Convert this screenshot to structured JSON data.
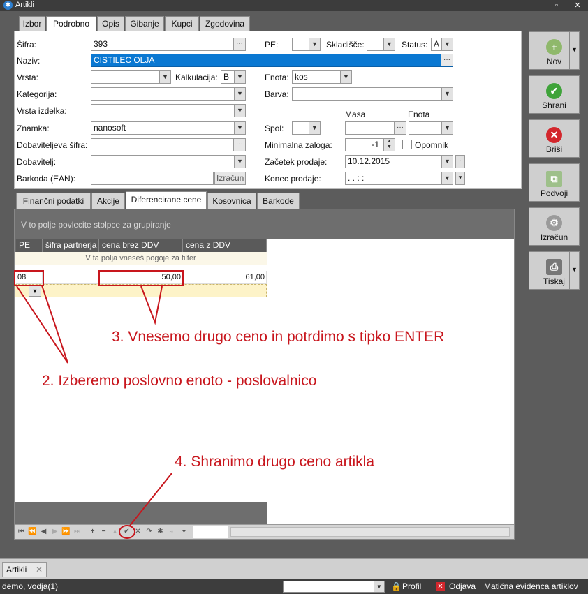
{
  "window": {
    "title": "Artikli"
  },
  "main_tabs": [
    "Izbor",
    "Podrobno",
    "Opis",
    "Gibanje",
    "Kupci",
    "Zgodovina"
  ],
  "form": {
    "sifra_label": "Šifra:",
    "sifra_value": "393",
    "naziv_label": "Naziv:",
    "naziv_value": "CISTILEC OLJA",
    "vrsta_label": "Vrsta:",
    "kalkulacija_label": "Kalkulacija:",
    "kalkulacija_value": "B",
    "kategorija_label": "Kategorija:",
    "vrsta_izdelka_label": "Vrsta izdelka:",
    "znamka_label": "Znamka:",
    "znamka_value": "nanosoft",
    "dobaviteljeva_sifra_label": "Dobaviteljeva šifra:",
    "dobavitelj_label": "Dobavitelj:",
    "barkoda_label": "Barkoda (EAN):",
    "izracun_button": "Izračun",
    "pe_label": "PE:",
    "skladisce_label": "Skladišče:",
    "status_label": "Status:",
    "status_value": "A",
    "enota_label": "Enota:",
    "enota_value": "kos",
    "barva_label": "Barva:",
    "masa_header": "Masa",
    "enota_header": "Enota",
    "spol_label": "Spol:",
    "minimalna_zaloga_label": "Minimalna zaloga:",
    "minimalna_zaloga_value": "-1",
    "opomnik_label": "Opomnik",
    "zacetek_label": "Začetek prodaje:",
    "zacetek_value": "10.12.2015",
    "konec_label": "Konec prodaje:",
    "konec_value": " .  .      :  :"
  },
  "sub_tabs": [
    "Finančni podatki",
    "Akcije",
    "Diferencirane cene",
    "Kosovnica",
    "Barkode"
  ],
  "grid": {
    "group_hint": "V to polje povlecite stolpce za grupiranje",
    "columns": [
      "PE",
      "šifra partnerja",
      "cena brez DDV",
      "cena z DDV"
    ],
    "filter_hint": "V ta polja vneseš pogoje za filter",
    "rows": [
      {
        "pe": "08",
        "partner": "",
        "brez": "50,00",
        "z": "61,00"
      }
    ]
  },
  "side_buttons": {
    "nov": "Nov",
    "shrani": "Shrani",
    "brisi": "Briši",
    "podvoji": "Podvoji",
    "izracun": "Izračun",
    "tiskaj": "Tiskaj"
  },
  "annotations": {
    "a2": "2. Izberemo poslovno enoto - poslovalnico",
    "a3": "3. Vnesemo drugo ceno in potrdimo s tipko ENTER",
    "a4": "4. Shranimo drugo ceno artikla"
  },
  "taskbar": {
    "tab": "Artikli"
  },
  "statusbar": {
    "user": "demo, vodja(1)",
    "profil": "Profil",
    "odjava": "Odjava",
    "module": "Matična evidenca artiklov"
  },
  "colors": {
    "selected_field": "#0a78d2",
    "annotation": "#c8161d",
    "new_row": "#fdf3c8"
  },
  "icons": [
    "app-icon",
    "minimize-icon",
    "close-icon",
    "new-doc-icon",
    "save-check-icon",
    "delete-x-icon",
    "duplicate-icon",
    "calc-gear-icon",
    "printer-icon",
    "filter-icon",
    "navigator-arrows"
  ]
}
